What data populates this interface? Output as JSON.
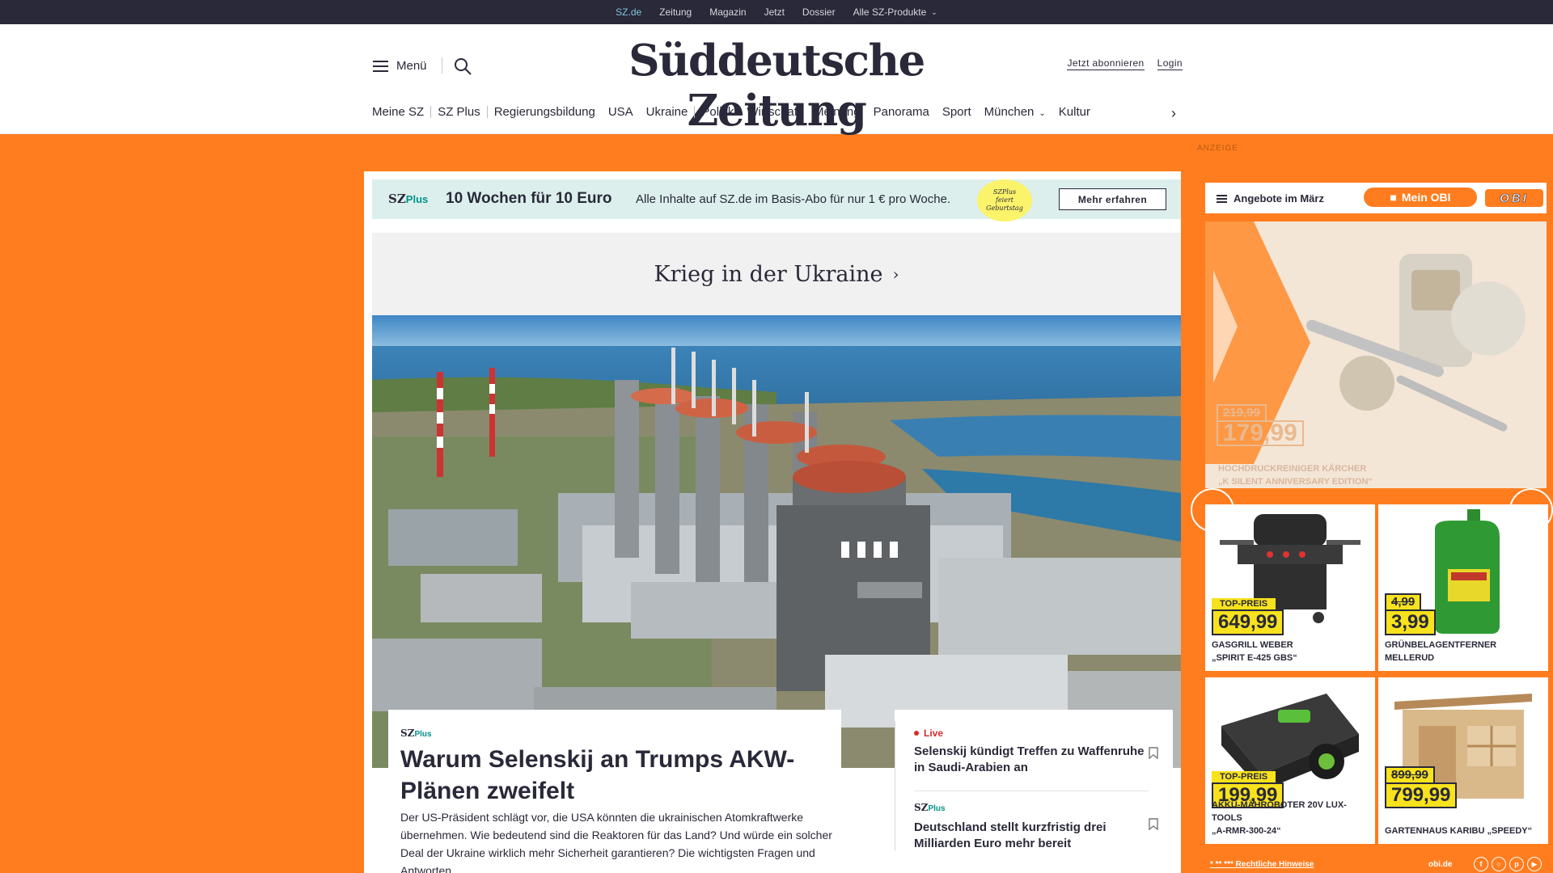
{
  "topbar": {
    "items": [
      "SZ.de",
      "Zeitung",
      "Magazin",
      "Jetzt",
      "Dossier"
    ],
    "products_label": "Alle SZ-Produkte"
  },
  "header": {
    "menu_label": "Menü",
    "logo": "Süddeutsche Zeitung",
    "subscribe_label": "Jetzt abonnieren",
    "login_label": "Login"
  },
  "nav": {
    "items": [
      "Meine SZ",
      "SZ Plus",
      "Regierungsbildung",
      "USA",
      "Ukraine",
      "Politik",
      "Wirtschaft",
      "Meinung",
      "Panorama",
      "Sport",
      "München",
      "Kultur"
    ]
  },
  "promo": {
    "brand": "SZ",
    "brand_plus": "Plus",
    "headline": "10 Wochen für 10 Euro",
    "text": "Alle Inhalte auf SZ.de im Basis-Abo für nur 1 € pro Woche.",
    "badge_line1": "SZPlus",
    "badge_line2": "feiert",
    "badge_line3": "Geburtstag",
    "button_label": "Mehr erfahren"
  },
  "section": {
    "title": "Krieg in der Ukraine"
  },
  "article": {
    "brand": "SZ",
    "brand_plus": "Plus",
    "title": "Warum Selenskij an Trumps AKW-Plänen zweifelt",
    "teaser": "Der US-Präsident schlägt vor, die USA könnten die ukrainischen Atomkraftwerke übernehmen. Wie bedeutend sind die Reaktoren für das Land? Und würde ein solcher Deal der Ukraine wirklich mehr Sicherheit garantieren? Die wichtigsten Fragen und Antworten."
  },
  "side_news": [
    {
      "kicker": "Live",
      "title": "Selenskij kündigt Treffen zu Waffenruhe in Saudi-Arabien an"
    },
    {
      "kicker_brand": "SZ",
      "kicker_plus": "Plus",
      "title": "Deutschland stellt kurzfristig drei Milliarden Euro mehr bereit"
    }
  ],
  "ad": {
    "label": "ANZEIGE",
    "menu_label": "Angebote im März",
    "mein_obi_label": "Mein OBI",
    "logo_text": "OBI",
    "hero_old_price": "219,99",
    "hero_price": "179,99",
    "hero_caption_line1": "HOCHDRUCKREINIGER KÄRCHER",
    "hero_caption_line2": "„K SILENT ANNIVERSARY EDITION“",
    "products": [
      {
        "tag": "TOP-PREIS",
        "price": "649,99",
        "name_line1": "GASGRILL WEBER",
        "name_line2": "„SPIRIT E-425 GBS“"
      },
      {
        "old_price": "4,99",
        "price": "3,99",
        "name_line1": "GRÜNBELAGENTFERNER",
        "name_line2": "MELLERUD"
      },
      {
        "tag": "TOP-PREIS",
        "price": "199,99",
        "name_line1": "AKKU-MÄHROBOTER 20V LUX-TOOLS",
        "name_line2": "„A-RMR-300-24“"
      },
      {
        "old_price": "899,99",
        "price": "799,99",
        "name_line1": "GARTENHAUS KARIBU „SPEEDY“",
        "name_line2": ""
      }
    ],
    "footer_hinweis": "* ** *** Rechtliche Hinweise",
    "footer_domain": "obi.de"
  },
  "colors": {
    "background_orange": "#ff7d1e",
    "topbar": "#29293a",
    "sz_plus_green": "#00928a",
    "live_red": "#d62c2c",
    "promo_bg": "#dcefec",
    "price_yellow": "#f8e21d"
  }
}
